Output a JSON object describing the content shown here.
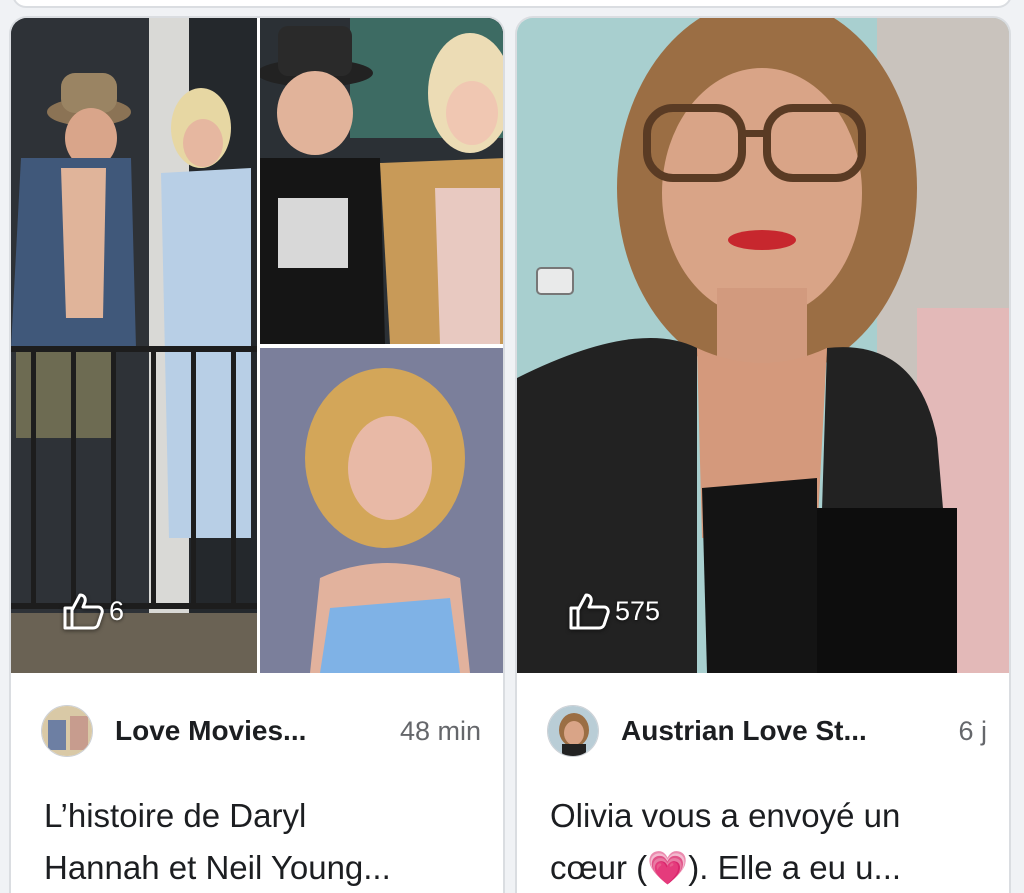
{
  "posts": [
    {
      "likes": "6",
      "author": "Love Movies...",
      "time": "48 min",
      "text_line1": "L’histoire de Daryl",
      "text_line2": "Hannah et Neil Young..."
    },
    {
      "likes": "575",
      "author": "Austrian Love St...",
      "time": "6 j",
      "text_line1": "Olivia vous a envoyé un",
      "text_line2_a": "cœur (",
      "text_line2_heart": "💗",
      "text_line2_b": "). Elle a eu u..."
    }
  ],
  "icons": {
    "like": "thumbs-up-outline-icon"
  },
  "colors": {
    "card_border": "#dadde1",
    "secondary_text": "#65676b",
    "background": "#f0f2f5"
  }
}
